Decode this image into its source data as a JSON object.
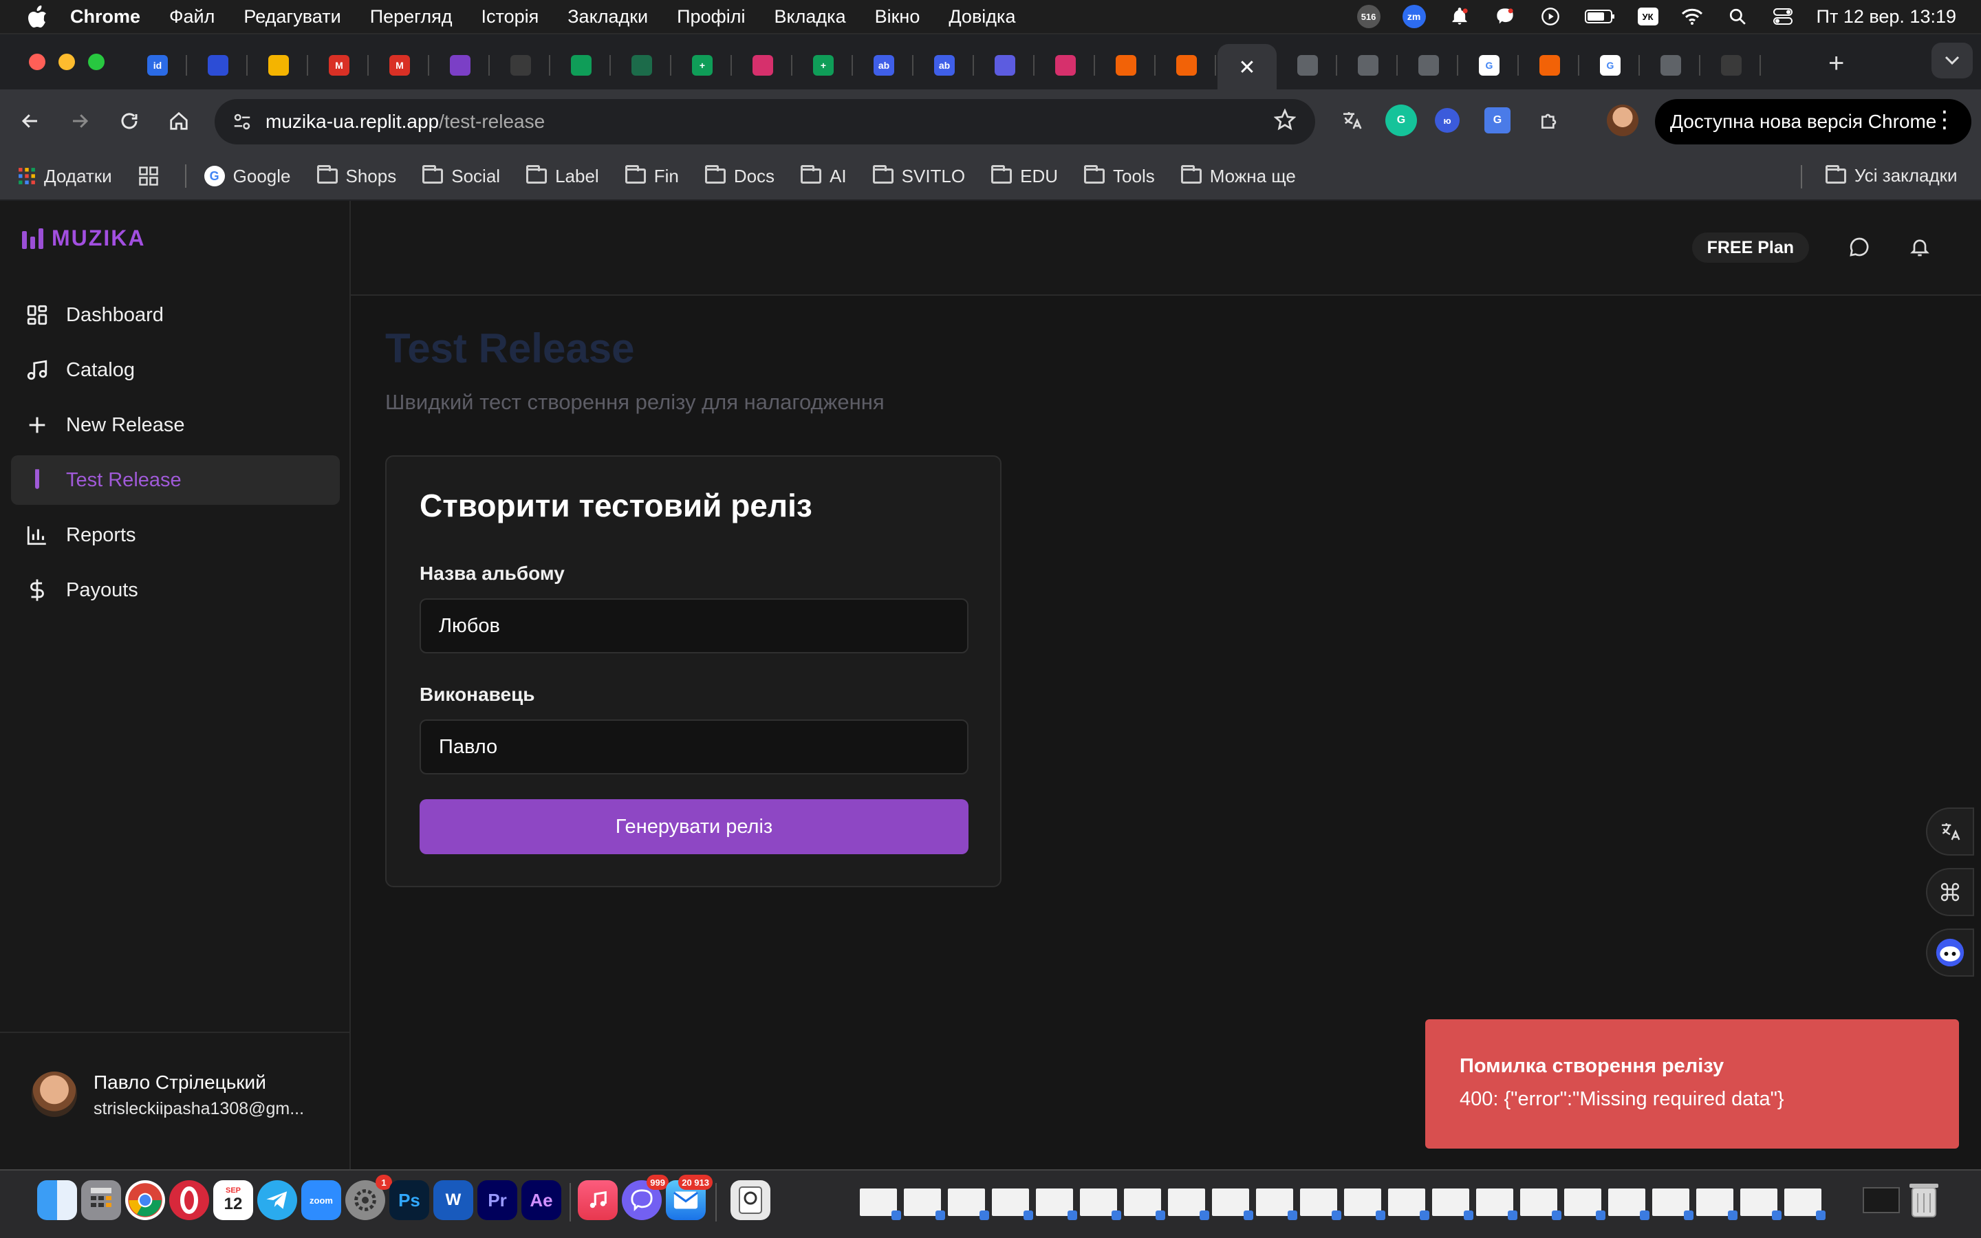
{
  "menubar": {
    "app": "Chrome",
    "items": [
      "Файл",
      "Редагувати",
      "Перегляд",
      "Історія",
      "Закладки",
      "Профілі",
      "Вкладка",
      "Вікно",
      "Довідка"
    ],
    "status_badge_count": "516",
    "status_zoom_label": "zm",
    "input_source": "УК",
    "clock": "Пт 12 вер.  13:19"
  },
  "tabs": {
    "favicons": [
      {
        "icon": "id-app-icon",
        "color": "#2b6be6",
        "label": "id"
      },
      {
        "icon": "pen-app-icon",
        "color": "#2c4dd6",
        "label": ""
      },
      {
        "icon": "google-drive-icon",
        "color": "#f4b400",
        "label": ""
      },
      {
        "icon": "gmail-icon",
        "color": "#d93025",
        "label": "M"
      },
      {
        "icon": "gmail-icon",
        "color": "#d93025",
        "label": "M"
      },
      {
        "icon": "bars-app-icon",
        "color": "#7b3fc6",
        "label": ""
      },
      {
        "icon": "openai-icon",
        "color": "#3a3a3a",
        "label": ""
      },
      {
        "icon": "google-drive-icon",
        "color": "#0f9d58",
        "label": ""
      },
      {
        "icon": "chart-app-icon",
        "color": "#1c6b4a",
        "label": ""
      },
      {
        "icon": "google-sheets-icon",
        "color": "#0f9d58",
        "label": "+"
      },
      {
        "icon": "instagram-icon",
        "color": "#d6306c",
        "label": ""
      },
      {
        "icon": "google-sheets-icon",
        "color": "#0f9d58",
        "label": "+"
      },
      {
        "icon": "meet-app-icon",
        "color": "#3f5fe8",
        "label": "ab"
      },
      {
        "icon": "meet-app-icon",
        "color": "#3f5fe8",
        "label": "ab"
      },
      {
        "icon": "headphones-app-icon",
        "color": "#5c5ce0",
        "label": ""
      },
      {
        "icon": "instagram-icon",
        "color": "#d6306c",
        "label": ""
      },
      {
        "icon": "replit-icon",
        "color": "#f26207",
        "label": ""
      },
      {
        "icon": "replit-icon",
        "color": "#f26207",
        "label": ""
      },
      {
        "icon": "close-icon",
        "color": "active",
        "label": "✕"
      },
      {
        "icon": "globe-icon",
        "color": "#5f6368",
        "label": ""
      },
      {
        "icon": "globe-icon",
        "color": "#5f6368",
        "label": ""
      },
      {
        "icon": "globe-icon",
        "color": "#5f6368",
        "label": ""
      },
      {
        "icon": "google-icon",
        "color": "#ffffff",
        "label": "G"
      },
      {
        "icon": "replit-icon",
        "color": "#f26207",
        "label": ""
      },
      {
        "icon": "google-icon",
        "color": "#ffffff",
        "label": "G"
      },
      {
        "icon": "globe-icon",
        "color": "#5f6368",
        "label": ""
      },
      {
        "icon": "openai-icon",
        "color": "#3a3a3a",
        "label": ""
      }
    ]
  },
  "toolbar": {
    "url_host": "muzika-ua.replit.app",
    "url_path": "/test-release",
    "update_label": "Доступна нова версія Chrome"
  },
  "bookmarks": {
    "apps_label": "Додатки",
    "items": [
      "Google",
      "Shops",
      "Social",
      "Label",
      "Fin",
      "Docs",
      "AI",
      "SVITLO",
      "EDU",
      "Tools",
      "Можна ще"
    ],
    "all_label": "Усі закладки"
  },
  "app": {
    "brand": "MUZIKA",
    "accent": "#9b4fd6",
    "nav": [
      {
        "label": "Dashboard",
        "icon": "dashboard-icon",
        "active": false
      },
      {
        "label": "Catalog",
        "icon": "music-note-icon",
        "active": false
      },
      {
        "label": "New Release",
        "icon": "plus-icon",
        "active": false
      },
      {
        "label": "Test Release",
        "icon": "test-tube-icon",
        "active": true
      },
      {
        "label": "Reports",
        "icon": "bar-chart-icon",
        "active": false
      },
      {
        "label": "Payouts",
        "icon": "dollar-icon",
        "active": false
      }
    ],
    "user": {
      "name": "Павло Стрілецький",
      "email": "strisleckiipasha1308@gm..."
    },
    "plan_label": "FREE Plan"
  },
  "main": {
    "title": "Test Release",
    "subtitle": "Швидкий тест створення релізу для налагодження",
    "card": {
      "title": "Створити тестовий реліз",
      "album_label": "Назва альбому",
      "album_value": "Любов",
      "artist_label": "Виконавець",
      "artist_value": "Павло",
      "submit_label": "Генерувати реліз"
    }
  },
  "toast": {
    "title": "Помилка створення релізу",
    "message": "400: {\"error\":\"Missing required data\"}",
    "color": "#d84f4f"
  },
  "dock": {
    "calendar_month": "SEP",
    "calendar_day": "12",
    "zoom_label": "zoom",
    "ps_label": "Ps",
    "word_label": "W",
    "pr_label": "Pr",
    "ae_label": "Ae",
    "settings_badge": "1",
    "viber_badge": "999",
    "mail_badge": "20 913"
  }
}
